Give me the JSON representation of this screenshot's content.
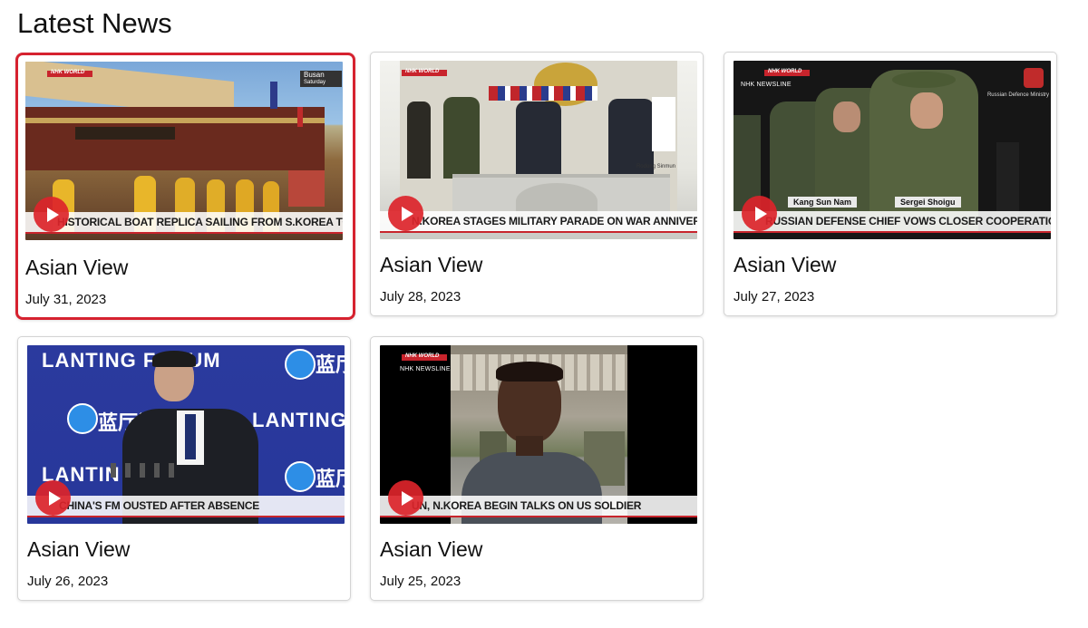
{
  "page": {
    "title": "Latest News"
  },
  "cards": [
    {
      "title": "Asian View",
      "date": "July 31, 2023",
      "caption": "HISTORICAL BOAT REPLICA SAILING FROM S.KOREA TO JAPAN",
      "location_tag": "Busan",
      "location_sub": "Saturday",
      "brand": "NHK WORLD"
    },
    {
      "title": "Asian View",
      "date": "July 28, 2023",
      "caption": "N.KOREA STAGES MILITARY PARADE ON WAR ANNIVERSARY",
      "brand": "NHK WORLD",
      "credit": "Rodong Sinmun"
    },
    {
      "title": "Asian View",
      "date": "July 27, 2023",
      "caption": "RUSSIAN DEFENSE CHIEF VOWS CLOSER COOPERATION WITH N.KOREA",
      "brand": "NHK WORLD",
      "newsline": "NHK NEWSLINE",
      "credit": "Russian Defence Ministry",
      "name_left": "Kang Sun Nam",
      "name_right": "Sergei Shoigu"
    },
    {
      "title": "Asian View",
      "date": "July 26, 2023",
      "caption": "CHINA'S FM OUSTED AFTER ABSENCE",
      "backdrop_text_1": "LANTING FORUM",
      "backdrop_text_2": "LANTING",
      "backdrop_text_3": "LANTIN",
      "backdrop_cn": "蓝厅论坛",
      "backdrop_cn_short": "蓝厅"
    },
    {
      "title": "Asian View",
      "date": "July 25, 2023",
      "caption": "UN, N.KOREA BEGIN TALKS ON US SOLDIER",
      "brand": "NHK WORLD",
      "newsline": "NHK NEWSLINE"
    }
  ],
  "colors": {
    "accent": "#d6222f",
    "nhk_red": "#c8242c",
    "card_border": "#d4d4d4"
  },
  "icons": [
    "play-icon"
  ]
}
